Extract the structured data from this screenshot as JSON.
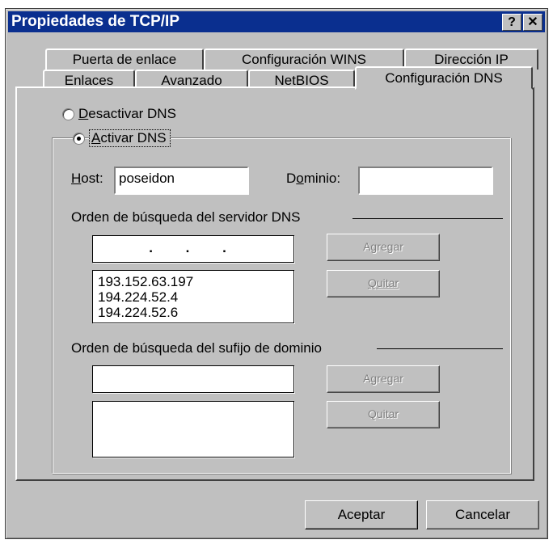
{
  "window": {
    "title": "Propiedades de TCP/IP",
    "help_glyph": "?",
    "close_glyph": "✕"
  },
  "tabs": {
    "back_row": [
      "Puerta de enlace",
      "Configuración WINS",
      "Dirección IP"
    ],
    "front_row": [
      "Enlaces",
      "Avanzado",
      "NetBIOS",
      "Configuración DNS"
    ],
    "active": "Configuración DNS"
  },
  "dns": {
    "disable_label_first": "D",
    "disable_label_rest": "esactivar DNS",
    "enable_label_first": "A",
    "enable_label_rest": "ctivar DNS",
    "selected": "Activar DNS",
    "host_label_first": "H",
    "host_label_rest": "ost:",
    "host_value": "poseidon",
    "domain_label_pre": "D",
    "domain_label_u": "o",
    "domain_label_post": "minio:",
    "domain_value": "",
    "server_order_label": "Orden de búsqueda del servidor DNS",
    "server_ip_placeholder": ".   .   .",
    "servers": [
      "193.152.63.197",
      "194.224.52.4",
      "194.224.52.6"
    ],
    "add_server_label": "Agregar",
    "remove_server_label": "Quitar",
    "suffix_order_label": "Orden de búsqueda del sufijo de dominio",
    "suffix_input": "",
    "suffixes": [],
    "add_suffix_label": "Agregar",
    "remove_suffix_label": "Quitar"
  },
  "footer": {
    "ok_label": "Aceptar",
    "cancel_label": "Cancelar"
  },
  "colors": {
    "titlebar": "#0a2f8f",
    "face": "#c0c0c0",
    "disabled_text": "#808080"
  }
}
